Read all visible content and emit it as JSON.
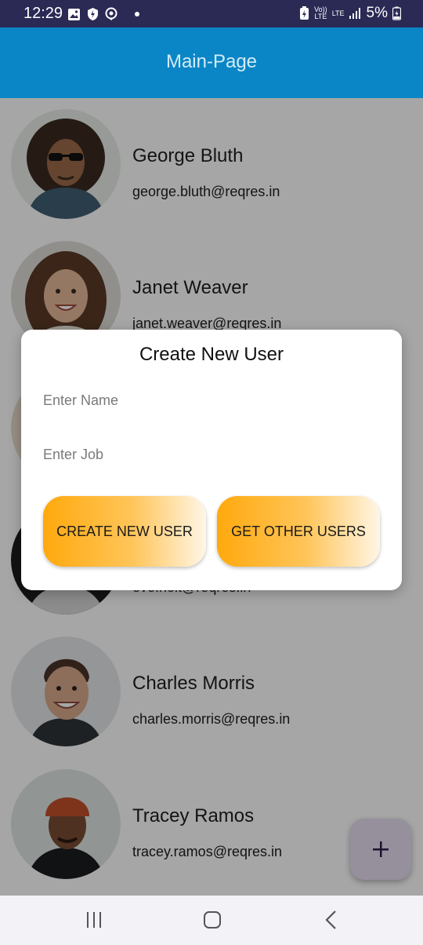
{
  "status_bar": {
    "time": "12:29",
    "volte_label": "Vo))\nLTE",
    "lte_label": "LTE",
    "battery": "5%"
  },
  "app_bar": {
    "title": "Main-Page"
  },
  "users": [
    {
      "name": "George Bluth",
      "email": "george.bluth@reqres.in"
    },
    {
      "name": "Janet Weaver",
      "email": "janet.weaver@reqres.in"
    },
    {
      "name": "",
      "email": ""
    },
    {
      "name": "",
      "email": "eve.holt@reqres.in"
    },
    {
      "name": "Charles Morris",
      "email": "charles.morris@reqres.in"
    },
    {
      "name": "Tracey Ramos",
      "email": "tracey.ramos@reqres.in"
    }
  ],
  "dialog": {
    "title": "Create New User",
    "name_placeholder": "Enter Name",
    "job_placeholder": "Enter Job",
    "create_button": "CREATE NEW USER",
    "get_users_button": "GET OTHER USERS"
  },
  "fab": {
    "icon": "plus-icon",
    "label": "+"
  },
  "nav_bar": {
    "icons": [
      "recents-icon",
      "home-icon",
      "back-icon"
    ]
  },
  "colors": {
    "status_bar": "#2b2a55",
    "app_bar": "#0a86c6",
    "button_gradient_start": "#ffa90d",
    "button_gradient_end": "#fff6e6",
    "fab": "#e6dcf0"
  }
}
